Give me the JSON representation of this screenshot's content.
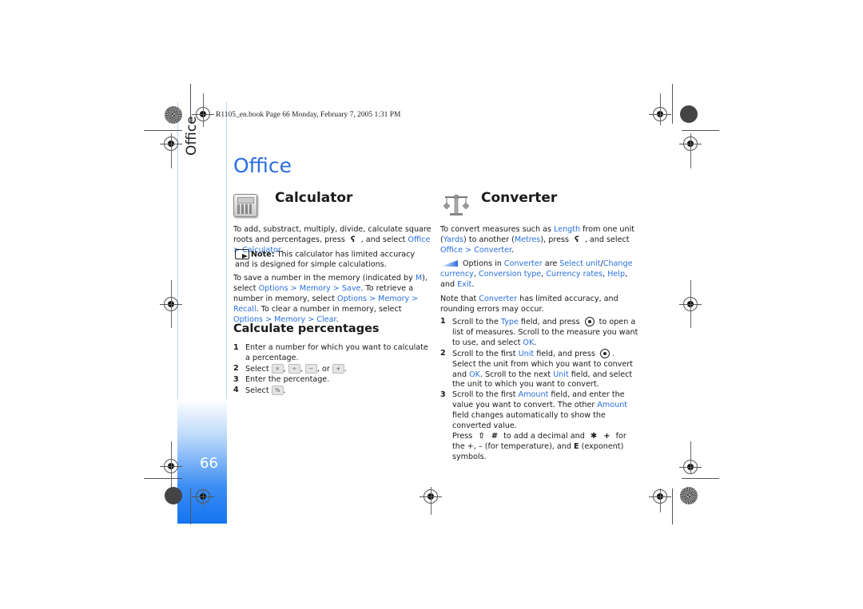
{
  "header": {
    "print_info": "R1105_en.book  Page 66  Monday, February 7, 2005  1:31 PM"
  },
  "side_tab": {
    "label": "Office",
    "page_number": "66"
  },
  "page_title": "Office",
  "calculator": {
    "title": "Calculator",
    "icon": "calculator-icon",
    "intro": {
      "t1": "To add, substract, multiply, divide, calculate square roots and percentages, press ",
      "t2": " , and select ",
      "link1": "Office > Calculator",
      "t3": "."
    },
    "note": {
      "label": "Note:",
      "text": " This calculator has limited accuracy and is designed for simple calculations."
    },
    "memory": {
      "t1": "To save a number in the memory (indicated by ",
      "m": "M",
      "t2": "), select ",
      "l1": "Options > Memory > Save",
      "t3": ". To retrieve a number in memory, select ",
      "l2": "Options > Memory > Recall",
      "t4": ". To clear a number in memory, select ",
      "l3": "Options > Memory > Clear",
      "t5": "."
    },
    "percent_title": "Calculate percentages",
    "steps": [
      {
        "n": "1",
        "text": "Enter a number for which you want to calculate a percentage."
      },
      {
        "n": "2",
        "pre": "Select ",
        "keys": [
          "×",
          "÷",
          "−",
          "+"
        ],
        "sep": ", ",
        "or": ", or ",
        "end": "."
      },
      {
        "n": "3",
        "text": "Enter the percentage."
      },
      {
        "n": "4",
        "pre": "Select ",
        "key": "%",
        "end": "."
      }
    ]
  },
  "converter": {
    "title": "Converter",
    "icon": "scale-icon",
    "intro": {
      "t1": "To convert measures such as ",
      "length": "Length",
      "t2": " from one unit (",
      "yards": "Yards",
      "t3": ") to another (",
      "metres": "Metres",
      "t4": "), press ",
      "t5": " , and select ",
      "link": "Office > Converter",
      "t6": "."
    },
    "tip": {
      "t1": "Options in ",
      "converter": "Converter",
      "t2": " are ",
      "o1": "Select unit",
      "slash": "/",
      "o2": "Change currency",
      "c1": ", ",
      "o3": "Conversion type",
      "c2": ", ",
      "o4": "Currency rates",
      "c3": ", ",
      "o5": "Help",
      "c4": ", and ",
      "o6": "Exit",
      "t3": "."
    },
    "note": {
      "t1": "Note that ",
      "converter": "Converter",
      "t2": " has limited accuracy, and rounding errors may occur."
    },
    "steps": [
      {
        "n": "1",
        "t1": "Scroll to the ",
        "h1": "Type",
        "t2": " field, and press ",
        "t3": " to open a list of measures. Scroll to the measure you want to use, and select ",
        "h2": "OK",
        "t4": "."
      },
      {
        "n": "2",
        "t1": "Scroll to the first ",
        "h1": "Unit",
        "t2": " field, and press ",
        "t3": ". Select the unit from which you want to convert and ",
        "h2": "OK",
        "t4": ". Scroll to the next ",
        "h3": "Unit",
        "t5": " field, and select the unit to which you want to convert."
      },
      {
        "n": "3",
        "t1": "Scroll to the first ",
        "h1": "Amount",
        "t2": " field, and enter the value you want to convert. The other ",
        "h2": "Amount",
        "t3": " field changes automatically to show the converted value.",
        "t4": "Press ",
        "k1": "⇧",
        "k2": "#",
        "t5": " to add a decimal and ",
        "k3": "✱",
        "k4": "+",
        "t6": " for the +, – (for temperature), and ",
        "e": "E",
        "t7": " (exponent) symbols."
      }
    ]
  },
  "colors": {
    "accent": "#2a6fe0",
    "tab_gradient_end": "#1374f1"
  }
}
